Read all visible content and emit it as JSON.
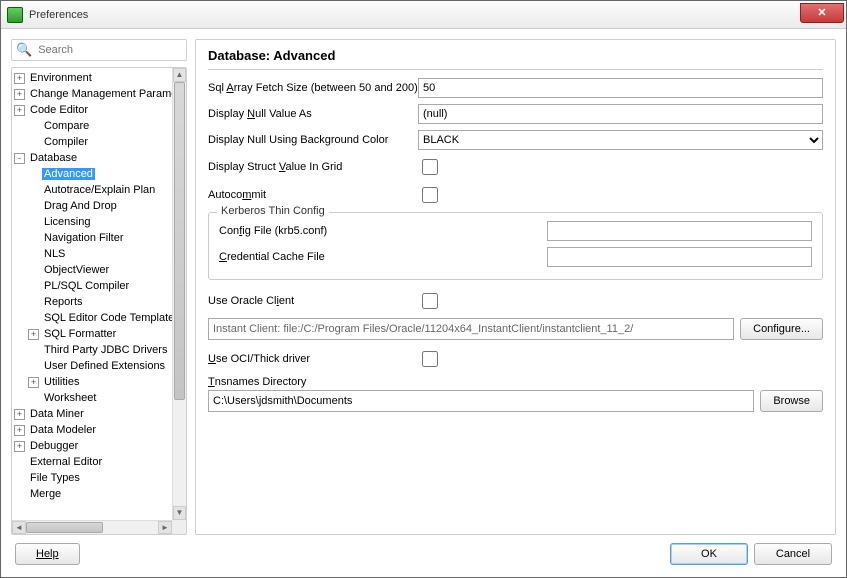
{
  "window": {
    "title": "Preferences"
  },
  "search": {
    "placeholder": "Search"
  },
  "tree": [
    {
      "label": "Environment",
      "exp": "+",
      "indent": 0
    },
    {
      "label": "Change Management Parameters",
      "exp": "+",
      "indent": 0
    },
    {
      "label": "Code Editor",
      "exp": "+",
      "indent": 0
    },
    {
      "label": "Compare",
      "exp": "",
      "indent": 1
    },
    {
      "label": "Compiler",
      "exp": "",
      "indent": 1
    },
    {
      "label": "Database",
      "exp": "-",
      "indent": 0
    },
    {
      "label": "Advanced",
      "exp": "",
      "indent": 1,
      "selected": true
    },
    {
      "label": "Autotrace/Explain Plan",
      "exp": "",
      "indent": 1
    },
    {
      "label": "Drag And Drop",
      "exp": "",
      "indent": 1
    },
    {
      "label": "Licensing",
      "exp": "",
      "indent": 1
    },
    {
      "label": "Navigation Filter",
      "exp": "",
      "indent": 1
    },
    {
      "label": "NLS",
      "exp": "",
      "indent": 1
    },
    {
      "label": "ObjectViewer",
      "exp": "",
      "indent": 1
    },
    {
      "label": "PL/SQL Compiler",
      "exp": "",
      "indent": 1
    },
    {
      "label": "Reports",
      "exp": "",
      "indent": 1
    },
    {
      "label": "SQL Editor Code Templates",
      "exp": "",
      "indent": 1
    },
    {
      "label": "SQL Formatter",
      "exp": "+",
      "indent": 1
    },
    {
      "label": "Third Party JDBC Drivers",
      "exp": "",
      "indent": 1
    },
    {
      "label": "User Defined Extensions",
      "exp": "",
      "indent": 1
    },
    {
      "label": "Utilities",
      "exp": "+",
      "indent": 1
    },
    {
      "label": "Worksheet",
      "exp": "",
      "indent": 1
    },
    {
      "label": "Data Miner",
      "exp": "+",
      "indent": 0
    },
    {
      "label": "Data Modeler",
      "exp": "+",
      "indent": 0
    },
    {
      "label": "Debugger",
      "exp": "+",
      "indent": 0
    },
    {
      "label": "External Editor",
      "exp": "",
      "indent": 0
    },
    {
      "label": "File Types",
      "exp": "",
      "indent": 0
    },
    {
      "label": "Merge",
      "exp": "",
      "indent": 0
    }
  ],
  "page": {
    "title": "Database: Advanced",
    "fetch_label_pre": "Sql ",
    "fetch_mn": "A",
    "fetch_label_post": "rray Fetch Size (between 50 and 200)",
    "fetch_value": "50",
    "null_label_pre": "Display ",
    "null_mn": "N",
    "null_label_post": "ull Value As",
    "null_value": "(null)",
    "nullbg_label": "Display Null Using Background Color",
    "nullbg_value": "BLACK",
    "struct_label_pre": "Display Struct ",
    "struct_mn": "V",
    "struct_label_post": "alue In Grid",
    "autocommit_label_pre": "Autoco",
    "autocommit_mn": "m",
    "autocommit_label_post": "mit",
    "kerberos_legend": "Kerberos Thin Config",
    "kerb_config_label_pre": "Con",
    "kerb_config_mn": "f",
    "kerb_config_label_post": "ig File (krb5.conf)",
    "kerb_cred_label_pre": "",
    "kerb_cred_mn": "C",
    "kerb_cred_label_post": "redential Cache File",
    "use_oracle_label_pre": "Use Oracle Cl",
    "use_oracle_mn": "i",
    "use_oracle_label_post": "ent",
    "client_value": "Instant Client: file:/C:/Program Files/Oracle/11204x64_InstantClient/instantclient_11_2/",
    "configure_label": "Configure...",
    "use_oci_label_pre": "",
    "use_oci_mn": "U",
    "use_oci_label_post": "se OCI/Thick driver",
    "tns_label_pre": "",
    "tns_mn": "T",
    "tns_label_post": "nsnames Directory",
    "tns_value": "C:\\Users\\jdsmith\\Documents",
    "browse_label": "Browse"
  },
  "footer": {
    "help": "Help",
    "ok": "OK",
    "cancel": "Cancel"
  }
}
